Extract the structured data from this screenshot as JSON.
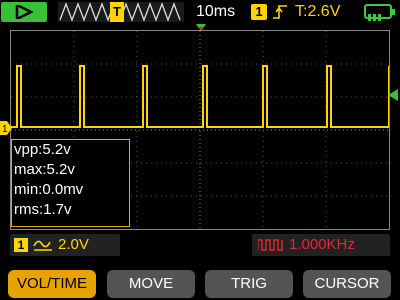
{
  "topbar": {
    "play_icon": "play-icon",
    "trigger_marker": "T",
    "timebase": "10ms",
    "channel": "1",
    "edge_icon": "rising-edge-icon",
    "trigger_level": "T:2.6V",
    "battery_icon": "battery-icon"
  },
  "measurements": {
    "vpp": "vpp:5.2v",
    "max": "max:5.2v",
    "min": "min:0.0mv",
    "rms": "rms:1.7v"
  },
  "status": {
    "channel": "1",
    "coupling_icon": "dc-coupling-icon",
    "volts_div": "2.0V",
    "freq_icon": "square-wave-icon",
    "frequency": "1.000KHz"
  },
  "buttons": {
    "vol_time": "VOL/TIME",
    "move": "MOVE",
    "trig": "TRIG",
    "cursor": "CURSOR"
  },
  "colors": {
    "trace": "#ffd400",
    "accent": "#e8a200",
    "freq": "#e8262d",
    "play": "#38c038"
  }
}
